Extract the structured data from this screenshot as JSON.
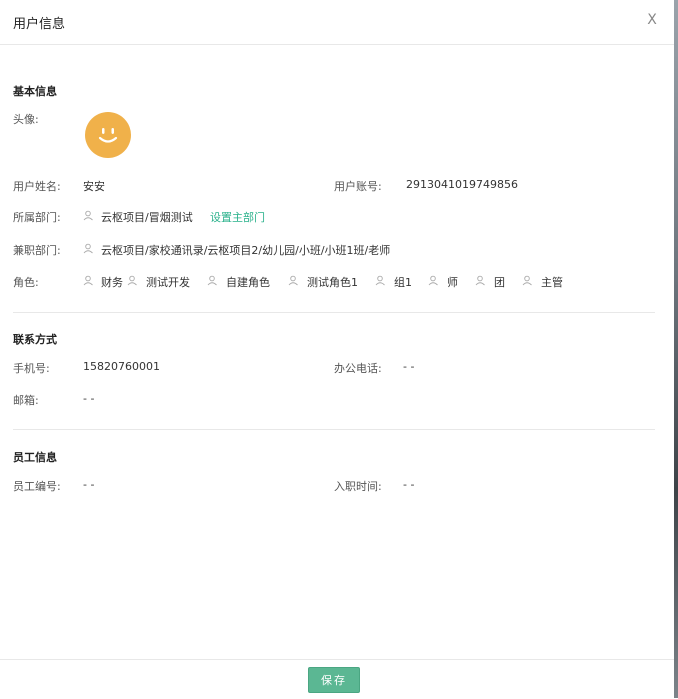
{
  "dialog": {
    "title": "用户信息",
    "close_label": "X"
  },
  "basic": {
    "section_title": "基本信息",
    "avatar_label": "头像:",
    "name_label": "用户姓名:",
    "name_value": "安安",
    "account_label": "用户账号:",
    "account_value": "2913041019749856",
    "dept_label": "所属部门:",
    "dept_value": "云枢项目/冒烟测试",
    "set_main_dept": "设置主部门",
    "parttime_label": "兼职部门:",
    "parttime_value": "云枢项目/家校通讯录/云枢项目2/幼儿园/小班/小班1班/老师",
    "role_label": "角色:",
    "roles": [
      "财务",
      "测试开发",
      "自建角色",
      "测试角色1",
      "组1",
      "师",
      "团",
      "主管"
    ]
  },
  "contact": {
    "section_title": "联系方式",
    "mobile_label": "手机号:",
    "mobile_value": "15820760001",
    "office_label": "办公电话:",
    "office_value": "- -",
    "email_label": "邮箱:",
    "email_value": "- -"
  },
  "employee": {
    "section_title": "员工信息",
    "number_label": "员工编号:",
    "number_value": "- -",
    "entry_label": "入职时间:",
    "entry_value": "- -"
  },
  "footer": {
    "save_label": "保存"
  },
  "colors": {
    "accent": "#5bb793",
    "link": "#2ab18b",
    "avatar": "#f0b14a"
  }
}
